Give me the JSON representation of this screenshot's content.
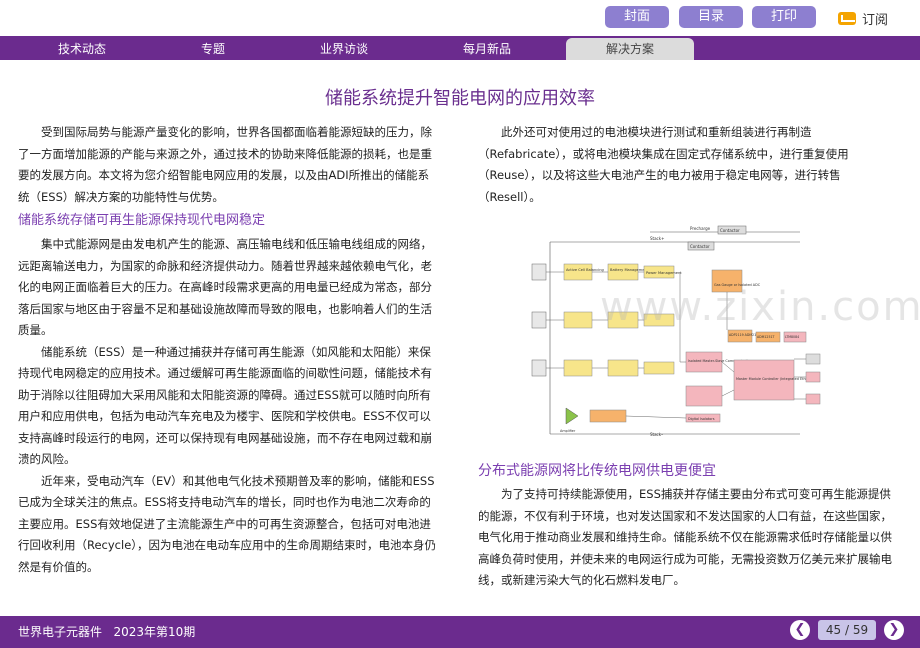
{
  "toolbar": {
    "cover": "封面",
    "toc": "目录",
    "print": "打印",
    "subscribe": "订阅"
  },
  "nav": {
    "tabs": [
      "技术动态",
      "专题",
      "业界访谈",
      "每月新品",
      "解决方案"
    ],
    "active_index": 4
  },
  "article": {
    "title": "储能系统提升智能电网的应用效率",
    "intro": "受到国际局势与能源产量变化的影响，世界各国都面临着能源短缺的压力，除了一方面增加能源的产能与来源之外，通过技术的协助来降低能源的损耗，也是重要的发展方向。本文将为您介绍智能电网应用的发展，以及由ADI所推出的储能系统（ESS）解决方案的功能特性与优势。",
    "section1_heading": "储能系统存储可再生能源保持现代电网稳定",
    "s1p1": "集中式能源网是由发电机产生的能源、高压输电线和低压输电线组成的网络，远距离输送电力，为国家的命脉和经济提供动力。随着世界越来越依赖电气化，老化的电网正面临着巨大的压力。在高峰时段需求更高的用电量已经成为常态，部分落后国家与地区由于容量不足和基础设施故障而导致的限电，也影响着人们的生活质量。",
    "s1p2": "储能系统（ESS）是一种通过捕获并存储可再生能源（如风能和太阳能）来保持现代电网稳定的应用技术。通过缓解可再生能源面临的间歇性问题，储能技术有助于消除以往阻碍加大采用风能和太阳能资源的障碍。通过ESS就可以随时向所有用户和应用供电，包括为电动汽车充电及为楼宇、医院和学校供电。ESS不仅可以支持高峰时段运行的电网，还可以保持现有电网基础设施，而不存在电网过载和崩溃的风险。",
    "s1p3": "近年来，受电动汽车（EV）和其他电气化技术预期普及率的影响，储能和ESS已成为全球关注的焦点。ESS将支持电动汽车的增长，同时也作为电池二次寿命的主要应用。ESS有效地促进了主流能源生产中的可再生资源整合，包括可对电池进行回收利用（Recycle），因为电池在电动车应用中的生命周期结束时，电池本身仍然是有价值的。",
    "right_p1": "此外还可对使用过的电池模块进行测试和重新组装进行再制造（Refabricate），或将电池模块集成在固定式存储系统中，进行重复使用（Reuse），以及将这些大电池产生的电力被用于稳定电网等，进行转售（Resell）。",
    "section2_heading": "分布式能源网将比传统电网供电更便宜",
    "s2p1": "为了支持可持续能源使用，ESS捕获并存储主要由分布式可变可再生能源提供的能源，不仅有利于环境，也对发达国家和不发达国家的人口有益，在这些国家，电气化用于推动商业发展和维持生命。储能系统不仅在能源需求低时存储能量以供高峰负荷时使用，并使未来的电网运行成为可能，无需投资数万亿美元来扩展输电线，或新建污染大气的化石燃料发电厂。"
  },
  "diagram": {
    "labels": {
      "precharge": "Precharge",
      "contactor": "Contactor",
      "stack_plus": "Stack+",
      "stack_minus": "Stack–",
      "cells": "6 to 16 Battery Cells",
      "active_cell": "Active Cell Balancing",
      "spi": "SPI",
      "battery_mgmt": "Battery Management",
      "power_mgmt": "Power Management",
      "gas_gauge": "Gas Gauge or Isolated ADC",
      "isolated_ms": "Isolated Master-Slave Communications",
      "adp": "ADP2119 ADM2170",
      "adm": "ADM1251T",
      "ltm": "LTM8084",
      "master": "Master Module Controller (Integrated Ethernet)",
      "diagnostics": "Diagnostics",
      "uart": "Isolated UART/RS-485",
      "can": "Isolated CAN",
      "digital_iso": "Digital Isolators",
      "amplifier": "Amplifier"
    },
    "colors": {
      "yellow": "#f7e58a",
      "pink": "#f4b6bd",
      "orange": "#f6b26b",
      "green": "#8bc34a"
    }
  },
  "watermark": "www.zixin.com.cn",
  "footer": {
    "magazine": "世界电子元器件",
    "issue": "2023年第10期",
    "page": "45 / 59"
  }
}
